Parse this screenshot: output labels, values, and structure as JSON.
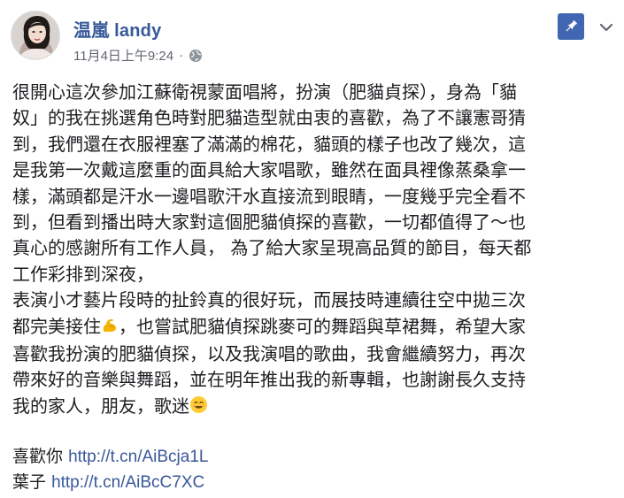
{
  "post": {
    "author": "温嵐 landy",
    "timestamp": "11月4日上午9:24",
    "separator": "·",
    "privacy_icon": "globe-icon",
    "pin_icon": "pin-icon",
    "menu_icon": "chevron-down-icon",
    "accent_color": "#4267b2",
    "name_color": "#365899",
    "body_lines": [
      "很開心這次參加江蘇衛視蒙面唱將，扮演（肥貓貞探），身為「貓",
      "奴」的我在挑選角色時對肥貓造型就由衷的喜歡，為了不讓憲哥猜",
      "到，我們還在衣服裡塞了滿滿的棉花，貓頭的樣子也改了幾次，這",
      "是我第一次戴這麼重的面具給大家唱歌，雖然在面具裡像蒸桑拿一",
      "樣，滿頭都是汗水一邊唱歌汗水直接流到眼睛，一度幾乎完全看不",
      "到，但看到播出時大家對這個肥貓偵探的喜歡，一切都值得了～也",
      "真心的感謝所有工作人員，  為了給大家呈現高品質的節目，每天都",
      "工作彩排到深夜，",
      "表演小才藝片段時的扯鈴真的很好玩，而展技時連續往空中拋三次"
    ],
    "line_10_before_emoji": "都完美接住",
    "line_10_emoji": "flexed-biceps-emoji",
    "line_10_after_emoji": "，也嘗試肥貓偵探跳麥可的舞蹈與草裙舞，希望大家",
    "body_lines_2": [
      "喜歡我扮演的肥貓偵探，以及我演唱的歌曲，我會繼續努力，再次",
      "帶來好的音樂與舞蹈，並在明年推出我的新專輯，也謝謝長久支持"
    ],
    "last_line_text": "我的家人，朋友，歌迷",
    "last_line_emoji": "smiling-face-emoji",
    "links": [
      {
        "label": "喜歡你",
        "url": "http://t.cn/AiBcja1L"
      },
      {
        "label": "葉子",
        "url": "http://t.cn/AiBcC7XC"
      }
    ]
  }
}
